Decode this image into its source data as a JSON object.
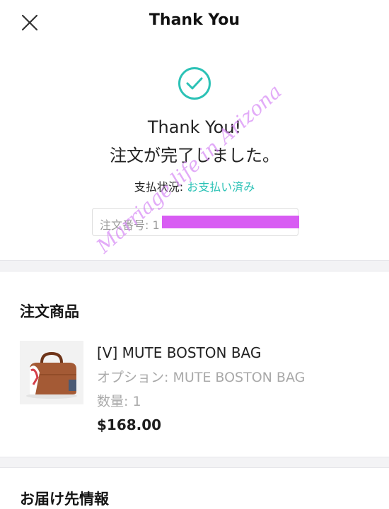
{
  "header": {
    "title": "Thank You",
    "close_icon": "close-icon"
  },
  "confirmation": {
    "icon": "check-circle-icon",
    "accent_color": "#2cc2b6",
    "line1": "Thank You!",
    "line2": "注文が完了しました。",
    "payment_label": "支払状況: ",
    "payment_value": "お支払い済み",
    "order_number_label": "注文番号: 1"
  },
  "order_items": {
    "title": "注文商品",
    "items": [
      {
        "name": "[V] MUTE BOSTON BAG",
        "option": "オプション: MUTE BOSTON BAG",
        "quantity": "数量: 1",
        "price": "$168.00"
      }
    ]
  },
  "next_section": {
    "title": "お届け先情報"
  },
  "watermark": {
    "text": "Marriage life in Arizona"
  },
  "colors": {
    "redaction": "#d85cf3",
    "watermark": "#d587f5",
    "section_gap": "#f3f3f5"
  }
}
